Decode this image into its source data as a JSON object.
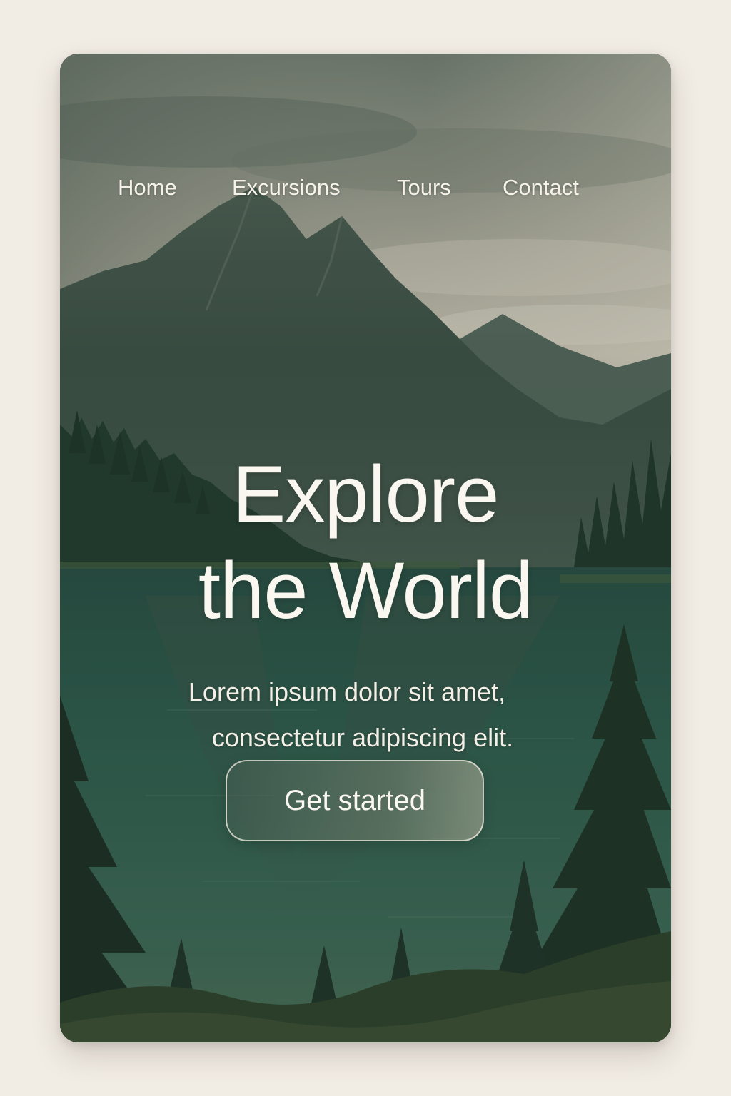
{
  "nav": {
    "items": [
      {
        "label": "Home"
      },
      {
        "label": "Excursions"
      },
      {
        "label": "Tours"
      },
      {
        "label": "Contact"
      }
    ]
  },
  "hero": {
    "title_line1": "Explore",
    "title_line2": "the World",
    "subtitle_line1": "Lorem ipsum dolor sit amet,",
    "subtitle_line2": "consectetur adipiscing elit.",
    "cta_label": "Get started"
  },
  "colors": {
    "page_background": "#f1ece4",
    "text": "#faf6f0",
    "lake": "#2f5a4c",
    "sky": "#cfc6b6"
  }
}
